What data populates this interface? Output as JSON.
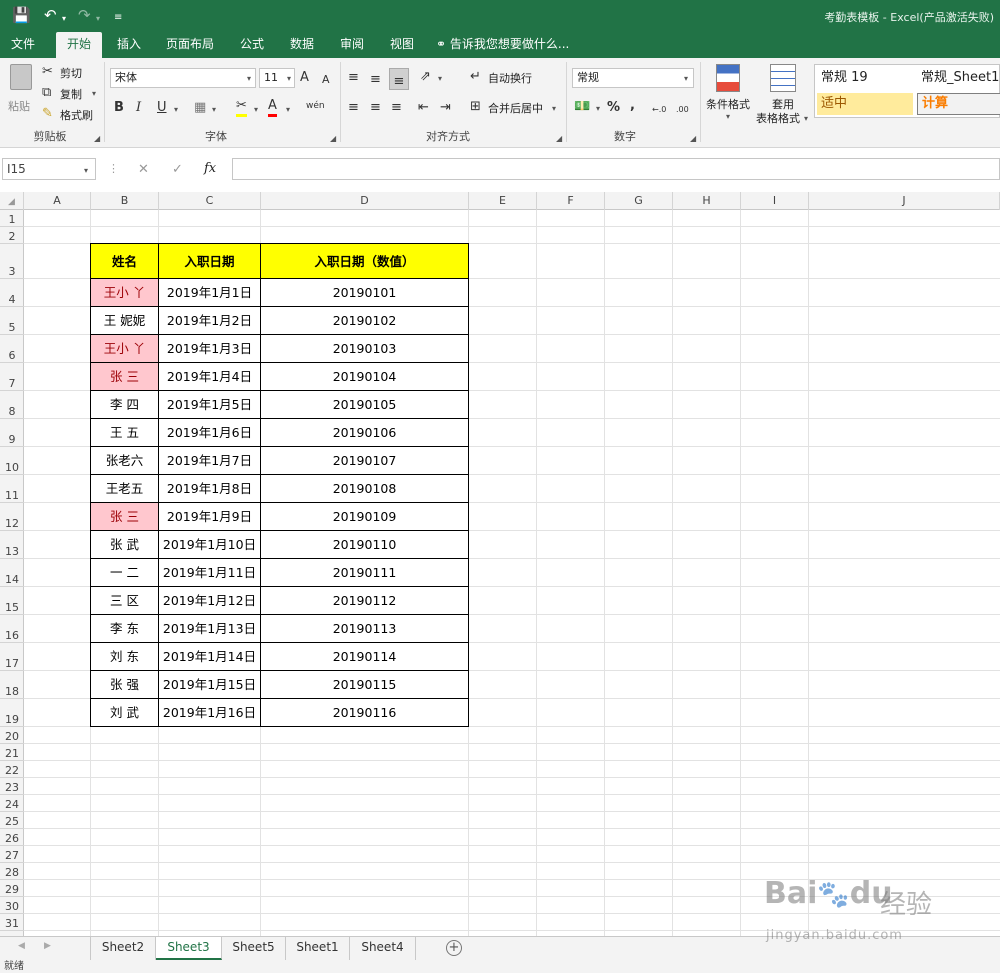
{
  "window": {
    "title": "考勤表模板 - Excel(产品激活失败)"
  },
  "quick_access": {
    "save_icon": "save-icon",
    "undo_icon": "undo-icon",
    "redo_icon": "redo-icon",
    "customize_icon": "customize-icon"
  },
  "tabs": [
    "文件",
    "开始",
    "插入",
    "页面布局",
    "公式",
    "数据",
    "审阅",
    "视图"
  ],
  "active_tab": "开始",
  "tell_me": "告诉我您想要做什么...",
  "clipboard": {
    "paste": "粘贴",
    "cut": "剪切",
    "copy": "复制",
    "format_painter": "格式刷",
    "label": "剪贴板"
  },
  "font": {
    "name": "宋体",
    "size": "11",
    "bold": "B",
    "italic": "I",
    "underline": "U",
    "label": "字体",
    "font_color_glyph": "A",
    "increase_glyph": "A",
    "decrease_glyph": "A",
    "wen_glyph": "wén"
  },
  "alignment": {
    "wrap": "自动换行",
    "merge": "合并后居中",
    "label": "对齐方式"
  },
  "number": {
    "format": "常规",
    "percent": "%",
    "comma": ",",
    "label": "数字",
    "inc_decimal": "←.0",
    "dec_decimal": ".00"
  },
  "styles": {
    "conditional": "条件格式",
    "table_format_1": "套用",
    "table_format_2": "表格格式",
    "gallery": [
      "常规 19",
      "常规_Sheet1",
      "适中",
      "计算"
    ]
  },
  "formula_bar": {
    "name_box": "I15",
    "fx": "fx",
    "cancel": "✕",
    "enter": "✓",
    "formula": ""
  },
  "columns": [
    "A",
    "B",
    "C",
    "D",
    "E",
    "F",
    "G",
    "H",
    "I",
    "J"
  ],
  "rows": [
    "1",
    "2",
    "3",
    "4",
    "5",
    "6",
    "7",
    "8",
    "9",
    "10",
    "11",
    "12",
    "13",
    "14",
    "15",
    "16",
    "17",
    "18",
    "19",
    "20",
    "21",
    "22",
    "23",
    "24",
    "25",
    "26",
    "27",
    "28",
    "29",
    "30",
    "31"
  ],
  "table": {
    "headers": [
      "姓名",
      "入职日期",
      "入职日期（数值）"
    ],
    "rows": [
      {
        "name": "王小 丫",
        "date": "2019年1月1日",
        "num": "20190101",
        "dup": true
      },
      {
        "name": "王 妮妮",
        "date": "2019年1月2日",
        "num": "20190102",
        "dup": false
      },
      {
        "name": "王小 丫",
        "date": "2019年1月3日",
        "num": "20190103",
        "dup": true
      },
      {
        "name": "张 三",
        "date": "2019年1月4日",
        "num": "20190104",
        "dup": true
      },
      {
        "name": "李 四",
        "date": "2019年1月5日",
        "num": "20190105",
        "dup": false
      },
      {
        "name": "王 五",
        "date": "2019年1月6日",
        "num": "20190106",
        "dup": false
      },
      {
        "name": "张老六",
        "date": "2019年1月7日",
        "num": "20190107",
        "dup": false
      },
      {
        "name": "王老五",
        "date": "2019年1月8日",
        "num": "20190108",
        "dup": false
      },
      {
        "name": "张 三",
        "date": "2019年1月9日",
        "num": "20190109",
        "dup": true
      },
      {
        "name": "张 武",
        "date": "2019年1月10日",
        "num": "20190110",
        "dup": false
      },
      {
        "name": "一 二",
        "date": "2019年1月11日",
        "num": "20190111",
        "dup": false
      },
      {
        "name": "三 区",
        "date": "2019年1月12日",
        "num": "20190112",
        "dup": false
      },
      {
        "name": "李 东",
        "date": "2019年1月13日",
        "num": "20190113",
        "dup": false
      },
      {
        "name": "刘 东",
        "date": "2019年1月14日",
        "num": "20190114",
        "dup": false
      },
      {
        "name": "张 强",
        "date": "2019年1月15日",
        "num": "20190115",
        "dup": false
      },
      {
        "name": "刘 武",
        "date": "2019年1月16日",
        "num": "20190116",
        "dup": false
      }
    ]
  },
  "sheets": [
    "Sheet2",
    "Sheet3",
    "Sheet5",
    "Sheet1",
    "Sheet4"
  ],
  "active_sheet": "Sheet3",
  "status": "就绪",
  "watermark": {
    "brand": "Bai",
    "brand2": "du",
    "cn": "经验",
    "url": "jingyan.baidu.com"
  },
  "colors": {
    "accent": "#217346",
    "header_fill": "#ffff00",
    "dup_fill": "#ffc7ce",
    "dup_text": "#9c0006"
  }
}
